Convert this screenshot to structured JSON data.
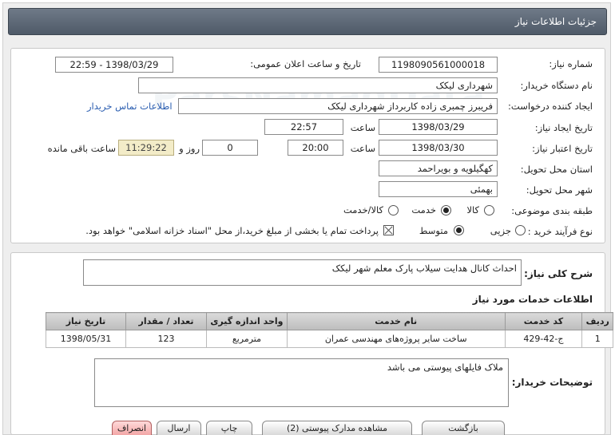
{
  "page": {
    "title": "جزئیات اطلاعات نیاز"
  },
  "form": {
    "need_number_label": "شماره نیاز:",
    "need_number": "1198090561000018",
    "announce_label": "تاریخ و ساعت اعلان عمومی:",
    "announce_value": "1398/03/29 - 22:59",
    "buyer_org_label": "نام دستگاه خریدار:",
    "buyer_org": "شهرداری لیکک",
    "requester_label": "ایجاد کننده درخواست:",
    "requester": "فریبرز  چمبری زاده کاربرداز شهرداری لیکک",
    "contact_link": "اطلاعات تماس خریدار",
    "created_date_label": "تاریخ ایجاد نیاز:",
    "created_date": "1398/03/29",
    "time_label": "ساعت",
    "created_time": "22:57",
    "validity_label": "تاریخ اعتبار نیاز:",
    "validity_date": "1398/03/30",
    "validity_time": "20:00",
    "days_value": "0",
    "days_label": "روز و",
    "remaining_time": "11:29:22",
    "remaining_label": "ساعت باقی مانده",
    "province_label": "استان محل تحویل:",
    "province": "کهگیلویه و بویراحمد",
    "city_label": "شهر محل تحویل:",
    "city": "بهمئی",
    "category_label": "طبقه بندی موضوعی:",
    "category_options": [
      "کالا",
      "خدمت",
      "کالا/خدمت"
    ],
    "category_selected": "خدمت",
    "process_label": "نوع فرآیند خرید :",
    "process_options": [
      "جزیی",
      "متوسط"
    ],
    "process_selected": "متوسط",
    "payment_note": "پرداخت تمام یا بخشی از مبلغ خرید،از محل \"اسناد خزانه اسلامی\" خواهد بود."
  },
  "summary": {
    "label": "شرح کلی نیاز:",
    "value": "احداث کانال هدایت سیلاب پارک معلم شهر لیکک"
  },
  "services": {
    "title": "اطلاعات خدمات مورد نیاز",
    "headers": [
      "ردیف",
      "کد خدمت",
      "نام خدمت",
      "واحد اندازه گیری",
      "تعداد / مقدار",
      "تاریخ نیاز"
    ],
    "rows": [
      [
        "1",
        "ج-42-429",
        "ساخت سایر پروژه‌های مهندسی عمران",
        "مترمربع",
        "123",
        "1398/05/31"
      ]
    ]
  },
  "buyer_notes": {
    "label": "توضیحات خریدار:",
    "value": "ملاک فایلهای پیوستی می باشد"
  },
  "bottom_buttons": [
    "بازگشت",
    "مشاهده مدارک پیوستی (2)",
    "چاپ",
    "ارسال",
    "انصراف"
  ]
}
